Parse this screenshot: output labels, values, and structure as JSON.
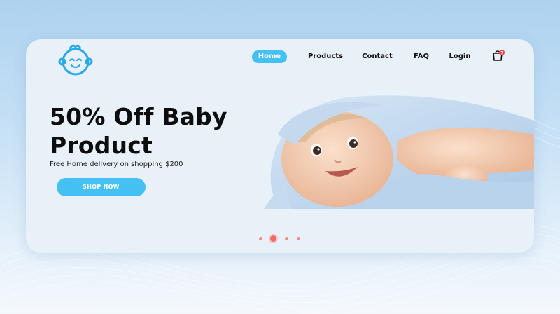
{
  "brand": {
    "logo_icon": "baby-face-logo",
    "accent": "#45c0f3"
  },
  "nav": {
    "items": [
      {
        "label": "Home",
        "active": true
      },
      {
        "label": "Products",
        "active": false
      },
      {
        "label": "Contact",
        "active": false
      },
      {
        "label": "FAQ",
        "active": false
      },
      {
        "label": "Login",
        "active": false
      }
    ],
    "cart_icon": "shopping-bag-icon",
    "cart_badge_color": "#ef4444"
  },
  "hero": {
    "title_line1": "50% Off Baby",
    "title_line2": "Product",
    "subtitle": "Free Home delivery on shopping $200",
    "cta_label": "SHOP NOW",
    "image_subject": "smiling baby in blue towel"
  },
  "carousel": {
    "slides": 4,
    "active_index": 1,
    "dot_color": "#ef6b6b"
  }
}
